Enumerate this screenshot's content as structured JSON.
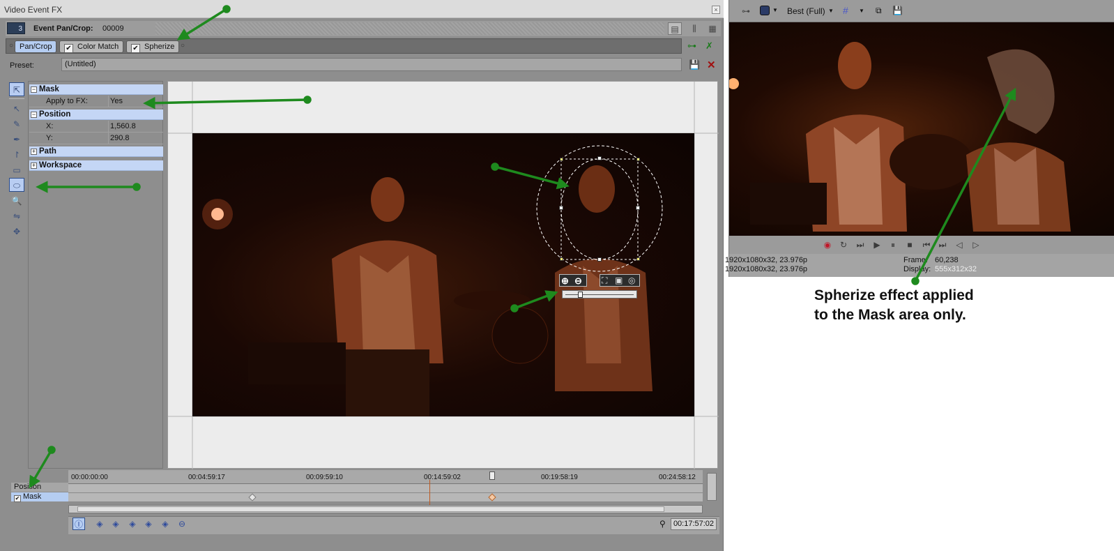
{
  "window": {
    "title": "Video Event FX"
  },
  "header": {
    "chip": "3",
    "label": "Event Pan/Crop:",
    "value": "00009"
  },
  "chain": [
    {
      "label": "Pan/Crop",
      "selected": true
    },
    {
      "label": "Color Match",
      "checked": true
    },
    {
      "label": "Spherize",
      "checked": true
    }
  ],
  "preset": {
    "label": "Preset:",
    "value": "(Untitled)"
  },
  "props": {
    "mask": {
      "title": "Mask",
      "apply_label": "Apply to FX:",
      "apply_value": "Yes"
    },
    "position": {
      "title": "Position",
      "x_label": "X:",
      "x_value": "1,560.8",
      "y_label": "Y:",
      "y_value": "290.8"
    },
    "path": {
      "title": "Path"
    },
    "workspace": {
      "title": "Workspace"
    }
  },
  "timeline": {
    "timecodes": [
      "00:00:00:00",
      "00:04:59:17",
      "00:09:59:10",
      "00:14:59:02",
      "00:19:58:19",
      "00:24:58:12"
    ],
    "tracks": [
      "Position",
      "Mask"
    ],
    "current_time": "00:17:57:02"
  },
  "preview": {
    "quality": "Best (Full)",
    "info_left_1": "1920x1080x32, 23.976p",
    "info_left_2": "1920x1080x32, 23.976p",
    "frame_label": "Frame:",
    "frame_value": "60,238",
    "display_label": "Display:",
    "display_value": "555x312x32"
  },
  "caption": {
    "line1": "Spherize effect applied",
    "line2": "to the Mask area only."
  },
  "colors": {
    "arrow": "#1e8a1e",
    "selection": "#b5cdf1",
    "panel": "#8e8e8e"
  },
  "icons": [
    "close-icon",
    "arrow-select-icon",
    "pen-icon",
    "ellipse-tool-icon",
    "rectangle-tool-icon",
    "zoom-icon",
    "save-icon",
    "delete-icon",
    "play-icon",
    "stop-icon",
    "record-icon"
  ]
}
